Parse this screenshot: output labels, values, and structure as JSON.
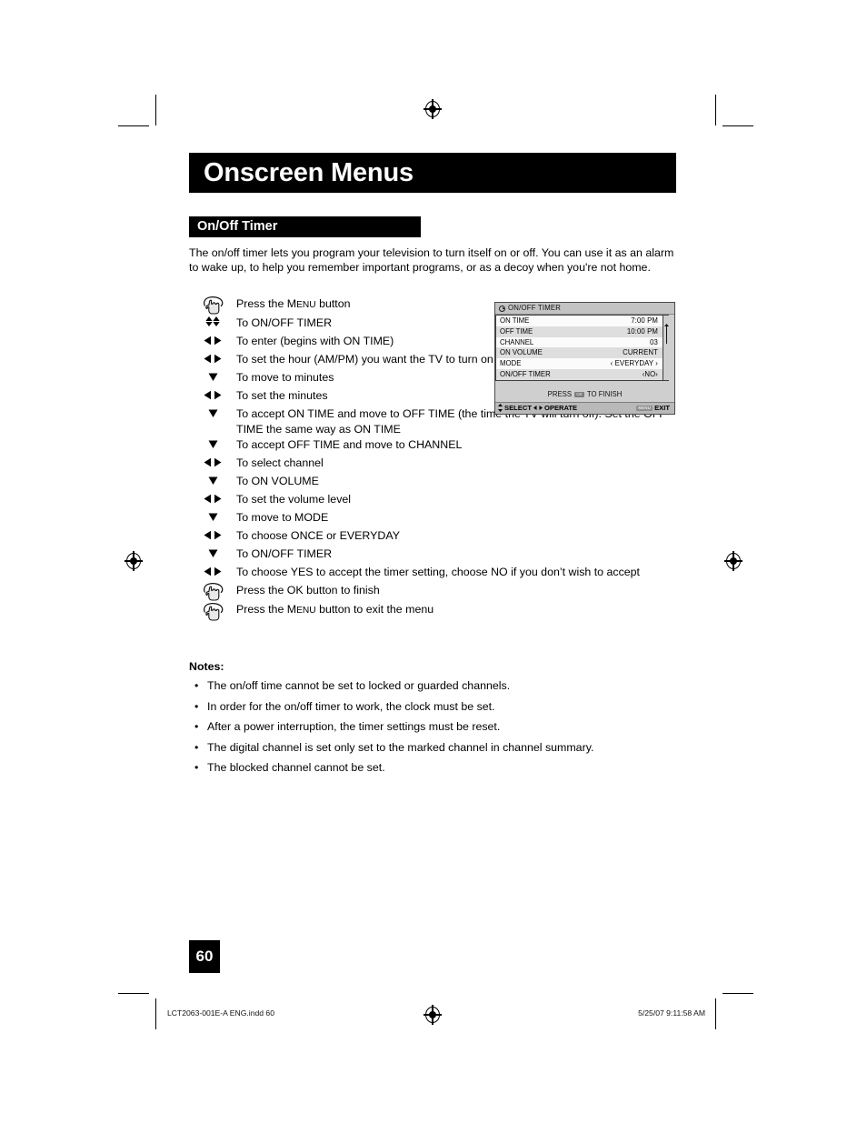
{
  "document": {
    "chapter_title": "Onscreen Menus",
    "section_title": "On/Off Timer",
    "intro": "The on/off timer lets you program your television to turn itself on or off. You can use it as an alarm to wake up, to help you remember important programs, or as a decoy when you're not home.",
    "page_number": "60"
  },
  "steps": [
    {
      "icon": "hand-press-button-icon",
      "glyph": "",
      "text_pre": "Press the ",
      "small_caps": "Menu",
      "text_post": " button"
    },
    {
      "icon": "up-down-arrows-icon",
      "glyph": "▲▼",
      "text": "To ON/OFF TIMER"
    },
    {
      "icon": "left-right-arrows-icon",
      "glyph": "◀▶",
      "text": "To enter (begins with ON TIME)"
    },
    {
      "icon": "left-right-arrows-icon",
      "glyph": "◀▶",
      "text": "To set the hour (AM/PM) you want the TV to turn on"
    },
    {
      "icon": "down-arrow-icon",
      "glyph": "▼",
      "text": "To move to minutes"
    },
    {
      "icon": "left-right-arrows-icon",
      "glyph": "◀▶",
      "text": "To set the minutes"
    },
    {
      "icon": "down-arrow-icon",
      "glyph": "▼",
      "text": "To accept ON TIME and move to OFF TIME (the time the TV will turn off). Set the OFF TIME the same way as ON TIME"
    },
    {
      "icon": "down-arrow-icon",
      "glyph": "▼",
      "text": "To accept OFF TIME and move to CHANNEL"
    },
    {
      "icon": "left-right-arrows-icon",
      "glyph": "◀▶",
      "text": "To select channel"
    },
    {
      "icon": "down-arrow-icon",
      "glyph": "▼",
      "text": "To ON VOLUME"
    },
    {
      "icon": "left-right-arrows-icon",
      "glyph": "◀▶",
      "text": "To set the volume level"
    },
    {
      "icon": "down-arrow-icon",
      "glyph": "▼",
      "text": "To move to MODE"
    },
    {
      "icon": "left-right-arrows-icon",
      "glyph": "◀▶",
      "text": "To choose ONCE or EVERYDAY"
    },
    {
      "icon": "down-arrow-icon",
      "glyph": "▼",
      "text": "To ON/OFF TIMER"
    },
    {
      "icon": "left-right-arrows-icon",
      "glyph": "◀▶",
      "text": "To choose YES to accept the timer setting, choose NO if you don’t wish to accept"
    },
    {
      "icon": "hand-press-button-icon",
      "glyph": "",
      "text": "Press the OK button to finish"
    },
    {
      "icon": "hand-press-button-icon",
      "glyph": "",
      "text_pre": "Press the ",
      "small_caps": "Menu",
      "text_post": " button to exit the menu"
    }
  ],
  "osd_menu": {
    "title": "ON/OFF TIMER",
    "title_icon": "clock-icon",
    "rows": [
      {
        "label": "ON TIME",
        "value": "7:00 PM"
      },
      {
        "label": "OFF TIME",
        "value": "10:00 PM"
      },
      {
        "label": "CHANNEL",
        "value": "03"
      },
      {
        "label": "ON VOLUME",
        "value": "CURRENT"
      },
      {
        "label": "MODE",
        "value": "‹ EVERYDAY ›"
      },
      {
        "label": "ON/OFF TIMER",
        "value": "‹NO›"
      }
    ],
    "press_pre": "PRESS",
    "press_chip": "OK",
    "press_post": "TO FINISH",
    "foot_select": "SELECT",
    "foot_select_icon": "up-down-arrows-icon",
    "foot_operate": "OPERATE",
    "foot_operate_icon": "left-right-arrows-icon",
    "foot_exit_chip": "MENU",
    "foot_exit": "EXIT"
  },
  "notes": {
    "title": "Notes:",
    "bullet": "•",
    "items": [
      "The on/off time cannot be set to locked or guarded channels.",
      "In order for the on/off timer to work, the clock must be set.",
      "After a power interruption, the timer settings must be reset.",
      "The digital channel is set only set to the marked channel in channel summary.",
      "The blocked channel cannot be set."
    ]
  },
  "print_footer": {
    "left": "LCT2063-001E-A ENG.indd   60",
    "right": "5/25/07   9:11:58 AM"
  }
}
